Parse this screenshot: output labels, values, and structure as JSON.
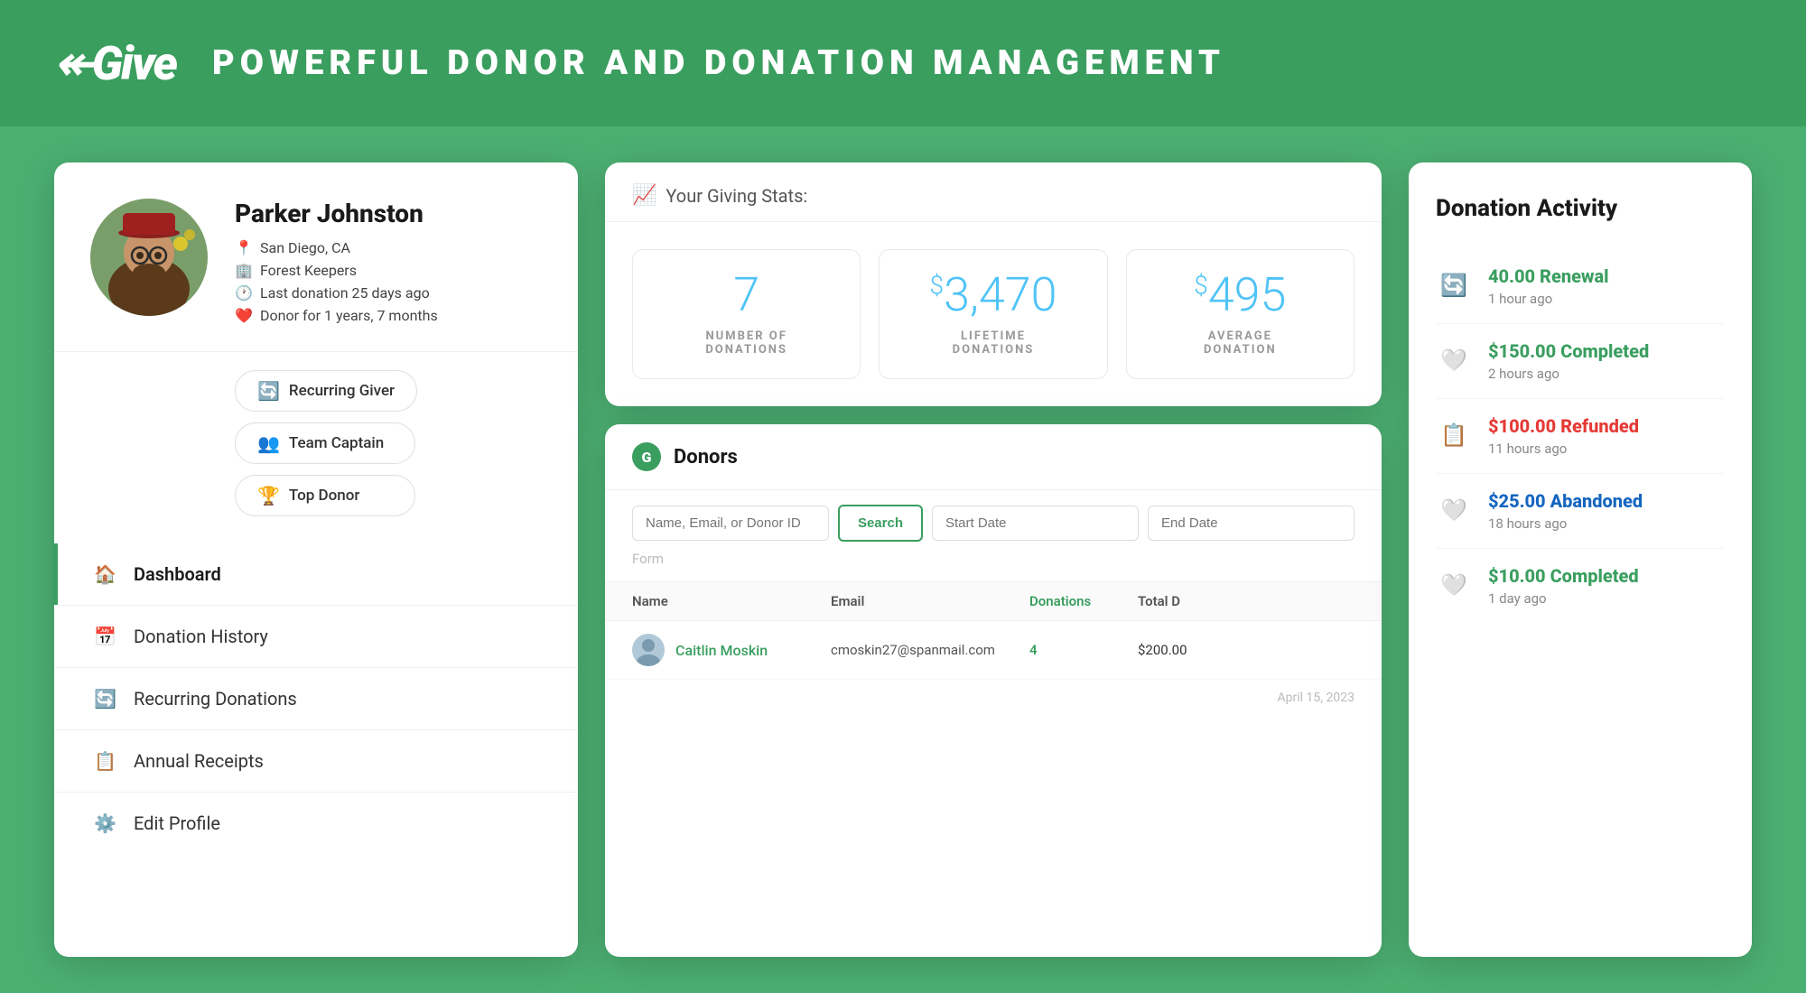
{
  "header": {
    "logo_text": "Give",
    "title": "POWERFUL DONOR AND DONATION MANAGEMENT"
  },
  "profile": {
    "name": "Parker Johnston",
    "location": "San Diego, CA",
    "organization": "Forest Keepers",
    "last_donation": "Last donation 25 days ago",
    "donor_duration": "Donor for 1 years, 7 months",
    "badges": [
      {
        "label": "Recurring Giver",
        "icon": "🔄"
      },
      {
        "label": "Team Captain",
        "icon": "👥"
      },
      {
        "label": "Top Donor",
        "icon": "🏆"
      }
    ]
  },
  "nav": {
    "items": [
      {
        "label": "Dashboard",
        "icon": "🏠",
        "active": true
      },
      {
        "label": "Donation History",
        "icon": "📅",
        "active": false
      },
      {
        "label": "Recurring Donations",
        "icon": "🔄",
        "active": false
      },
      {
        "label": "Annual Receipts",
        "icon": "📋",
        "active": false
      },
      {
        "label": "Edit Profile",
        "icon": "⚙️",
        "active": false
      }
    ]
  },
  "stats": {
    "header_label": "Your Giving Stats:",
    "items": [
      {
        "value": "7",
        "label": "NUMBER OF\nDONATIONS",
        "prefix": ""
      },
      {
        "value": "3,470",
        "label": "LIFETIME\nDONATIONS",
        "prefix": "$"
      },
      {
        "value": "495",
        "label": "AVERAGE\nDONATION",
        "prefix": "$"
      }
    ]
  },
  "donors": {
    "title": "Donors",
    "search_placeholder": "Name, Email, or Donor ID",
    "search_button": "Search",
    "start_date_placeholder": "Start Date",
    "end_date_placeholder": "End Date",
    "form_placeholder": "Form",
    "columns": [
      "Name",
      "Email",
      "Donations",
      "Total D"
    ],
    "rows": [
      {
        "name": "Caitlin Moskin",
        "email": "cmoskin27@spanmail.com",
        "donations": "4",
        "total": "$200.00"
      }
    ],
    "footer_date": "April 15, 2023"
  },
  "activity": {
    "title": "Donation Activity",
    "items": [
      {
        "amount": "40.00 Renewal",
        "time": "1 hour ago",
        "type": "renewal",
        "icon": "renewal"
      },
      {
        "amount": "$150.00 Completed",
        "time": "2 hours ago",
        "type": "completed",
        "icon": "heart"
      },
      {
        "amount": "$100.00 Refunded",
        "time": "11 hours ago",
        "type": "refunded",
        "icon": "list"
      },
      {
        "amount": "$25.00 Abandoned",
        "time": "18 hours ago",
        "type": "abandoned",
        "icon": "heart"
      },
      {
        "amount": "$10.00 Completed",
        "time": "1 day ago",
        "type": "completed",
        "icon": "heart"
      }
    ]
  }
}
